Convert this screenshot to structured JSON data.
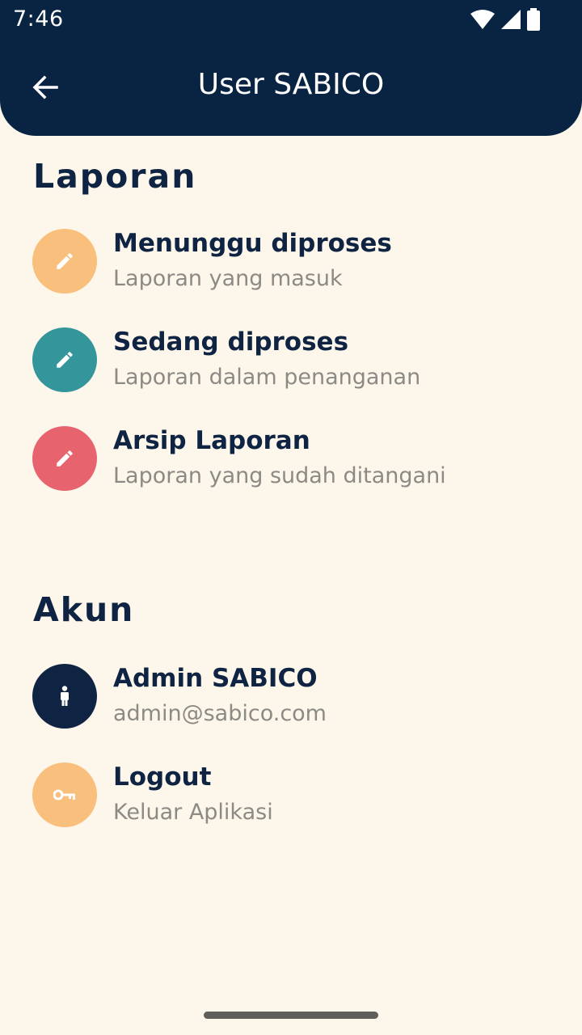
{
  "status_bar": {
    "time": "7:46"
  },
  "app_bar": {
    "title": "User SABICO",
    "background_color": "#082442"
  },
  "sections": {
    "laporan": {
      "title": "Laporan",
      "items": [
        {
          "title": "Menunggu diproses",
          "subtitle": "Laporan yang masuk",
          "icon": "pencil-icon",
          "color": "#f9bf7d"
        },
        {
          "title": "Sedang diproses",
          "subtitle": "Laporan dalam penanganan",
          "icon": "pencil-icon",
          "color": "#34969a"
        },
        {
          "title": "Arsip Laporan",
          "subtitle": "Laporan yang sudah ditangani",
          "icon": "pencil-icon",
          "color": "#e7646f"
        }
      ]
    },
    "akun": {
      "title": "Akun",
      "items": [
        {
          "title": "Admin SABICO",
          "subtitle": "admin@sabico.com",
          "icon": "person-icon",
          "color": "#0f2442"
        },
        {
          "title": "Logout",
          "subtitle": "Keluar Aplikasi",
          "icon": "key-icon",
          "color": "#f9bf7d"
        }
      ]
    }
  }
}
